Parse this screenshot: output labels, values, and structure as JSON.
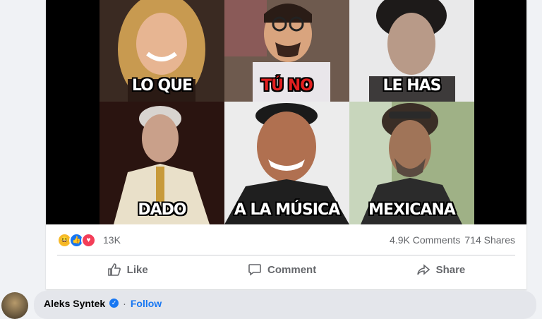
{
  "meme": {
    "captions": [
      "LO QUE",
      "TÚ NO",
      "LE HAS",
      "DADO",
      "A LA MÚSICA",
      "MEXICANA"
    ]
  },
  "stats": {
    "reactions_count": "13K",
    "comments": "4.9K Comments",
    "shares": "714 Shares"
  },
  "actions": {
    "like": "Like",
    "comment": "Comment",
    "share": "Share"
  },
  "comment": {
    "author": "Aleks Syntek",
    "separator": "·",
    "follow": "Follow"
  }
}
